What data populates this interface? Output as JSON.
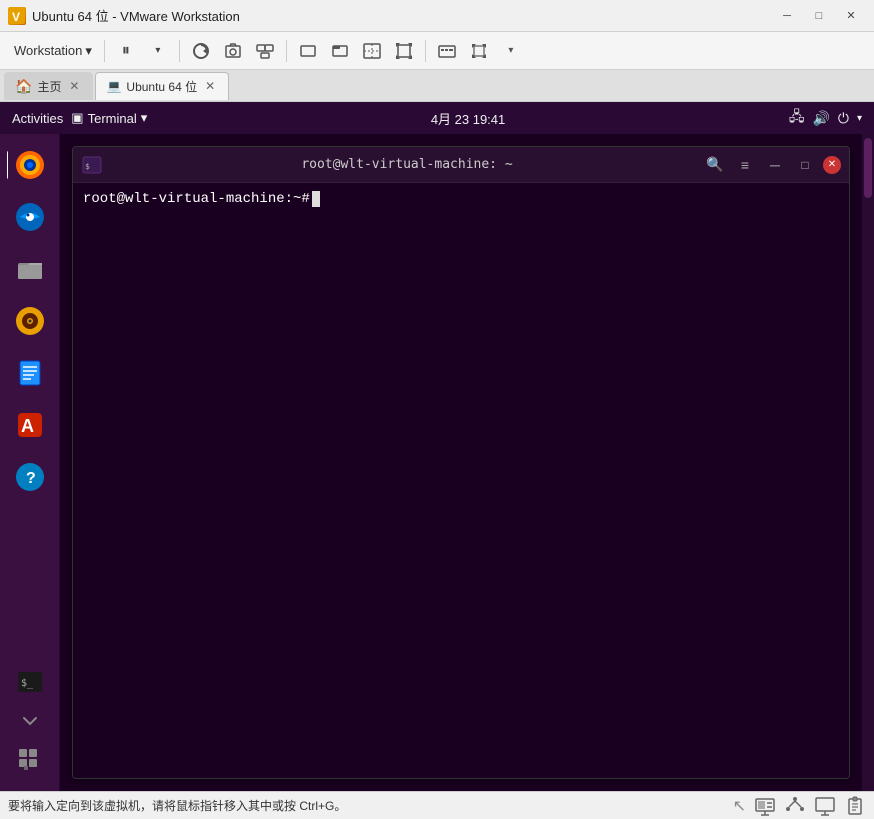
{
  "titlebar": {
    "icon": "▶",
    "text": "Ubuntu 64 位 - VMware Workstation",
    "btn_minimize": "─",
    "btn_restore": "□",
    "btn_close": "✕"
  },
  "toolbar": {
    "workstation_label": "Workstation",
    "dropdown_arrow": "▾",
    "buttons": [
      {
        "name": "pause",
        "icon": "⏸",
        "has_arrow": true
      },
      {
        "name": "separator1"
      },
      {
        "name": "snapshot-restore",
        "icon": "↺"
      },
      {
        "name": "snapshot-take",
        "icon": "📷"
      },
      {
        "name": "snapshot-manager",
        "icon": "🗂"
      },
      {
        "name": "separator2"
      },
      {
        "name": "view-normal",
        "icon": "▭"
      },
      {
        "name": "view-fullscreen-tab",
        "icon": "▬"
      },
      {
        "name": "view-stretch",
        "icon": "⤡"
      },
      {
        "name": "view-autofit",
        "icon": "⤢"
      },
      {
        "name": "separator3"
      },
      {
        "name": "send-ctrlaltdel",
        "icon": "⌨"
      },
      {
        "name": "view-fullscreen",
        "icon": "⛶",
        "has_arrow": true
      }
    ]
  },
  "tabs": [
    {
      "id": "home",
      "label": "主页",
      "icon": "🏠",
      "active": false,
      "closeable": true
    },
    {
      "id": "ubuntu",
      "label": "Ubuntu 64 位",
      "icon": "💻",
      "active": true,
      "closeable": true
    }
  ],
  "ubuntu": {
    "topbar": {
      "activities": "Activities",
      "terminal_label": "Terminal",
      "terminal_arrow": "▾",
      "datetime": "4月 23  19:41",
      "network_icon": "🖧",
      "volume_icon": "🔊",
      "power_icon": "⏻",
      "power_arrow": "▾"
    },
    "sidebar_apps": [
      {
        "name": "firefox",
        "icon": "🦊",
        "active": true,
        "label": "Firefox"
      },
      {
        "name": "thunderbird",
        "icon": "✉",
        "active": false,
        "label": "Thunderbird"
      },
      {
        "name": "files",
        "icon": "📁",
        "active": false,
        "label": "Files"
      },
      {
        "name": "rhythmbox",
        "icon": "🎵",
        "active": false,
        "label": "Rhythmbox"
      },
      {
        "name": "writer",
        "icon": "📝",
        "active": false,
        "label": "Writer"
      },
      {
        "name": "appstore",
        "icon": "🛒",
        "active": false,
        "label": "App Store"
      },
      {
        "name": "help",
        "icon": "?",
        "active": false,
        "label": "Help"
      },
      {
        "name": "terminal",
        "icon": "$ _",
        "active": false,
        "label": "Terminal"
      },
      {
        "name": "bottom-arrow",
        "icon": "⌄",
        "label": "Arrow"
      },
      {
        "name": "grid",
        "icon": "⊞",
        "label": "Show Applications"
      }
    ],
    "terminal": {
      "title": "root@wlt-virtual-machine: ~",
      "prompt": "root@wlt-virtual-machine:~#",
      "icon": "📄",
      "search_icon": "🔍",
      "menu_icon": "≡"
    }
  },
  "statusbar": {
    "hint_text": "要将输入定向到该虚拟机，请将鼠标指针移入其中或按 Ctrl+G。",
    "icons": [
      "🖥",
      "🔊",
      "📺",
      "📋"
    ]
  }
}
